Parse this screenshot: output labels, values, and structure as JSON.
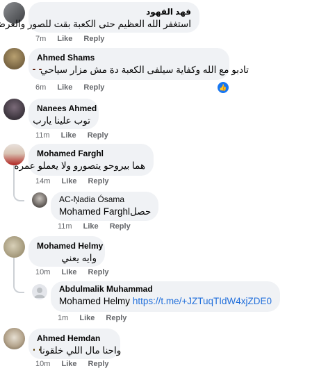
{
  "comments": [
    {
      "author": "فهد الفهود",
      "text": "استغفر الله العظيم حتى الكعبة بقت للصور والعرض",
      "time": "7m",
      "like": "Like",
      "reply": "Reply"
    },
    {
      "author": "Ahmed Shams",
      "text": "تادبو مع الله وكفاية سيلفى الكعبة دة مش مزار سياحي",
      "time": "6m",
      "like": "Like",
      "reply": "Reply",
      "reaction": "like-icon"
    },
    {
      "author": "Nanees Ahmed",
      "text": "توب علينا يارب",
      "time": "11m",
      "like": "Like",
      "reply": "Reply"
    },
    {
      "author": "Mohamed Farghl",
      "text": "هما بيروحو يتصورو ولا يعملو عمره",
      "time": "14m",
      "like": "Like",
      "reply": "Reply"
    },
    {
      "author": "AC-Ņadia Ósama",
      "tag": "Mohamed Farghl",
      "text": "حصل",
      "time": "11m",
      "like": "Like",
      "reply": "Reply"
    },
    {
      "author": "Mohamed Helmy",
      "text": "وايه يعني",
      "time": "10m",
      "like": "Like",
      "reply": "Reply"
    },
    {
      "author": "Abdulmalik Muhammad",
      "tag": "Mohamed Helmy",
      "link": "https://t.me/+JZTuqTIdW4xjZDE0",
      "time": "1m",
      "like": "Like",
      "reply": "Reply"
    },
    {
      "author": "Ahmed Hemdan",
      "text": "واحنا مال اللي خلقونا",
      "time": "10m",
      "like": "Like",
      "reply": "Reply"
    }
  ]
}
